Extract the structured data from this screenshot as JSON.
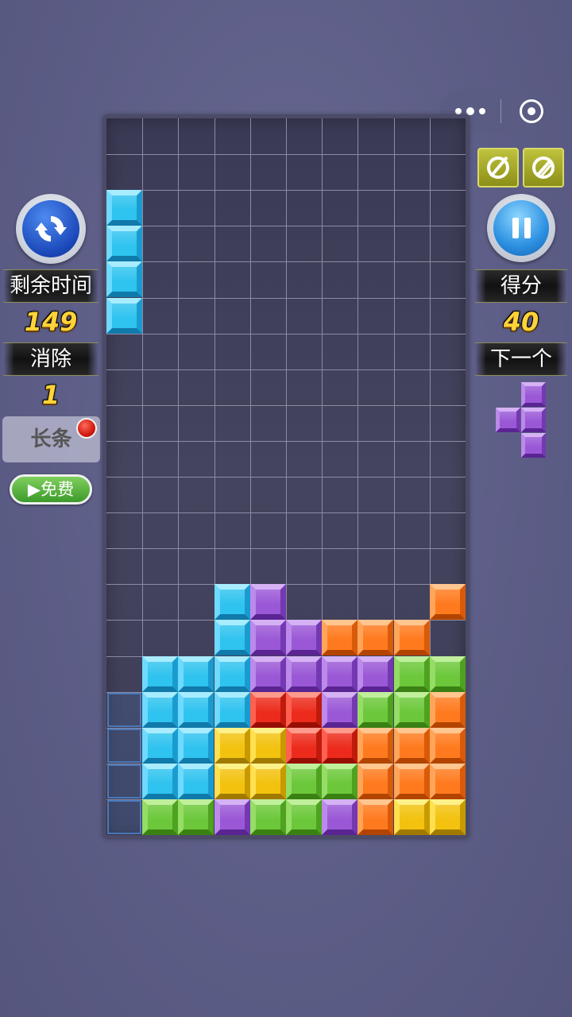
{
  "capsule": {
    "more_icon": "more-dots-icon",
    "close_icon": "target-circle-icon"
  },
  "left_panel": {
    "restart_icon": "refresh-arrows-icon",
    "time_label": "剩余时间",
    "time_value": "149",
    "lines_label": "消除",
    "lines_value": "1",
    "powerup_label": "长条",
    "free_button_label": "▶免费"
  },
  "right_panel": {
    "sound_icon": "sound-off-icon",
    "music_icon": "music-off-icon",
    "pause_icon": "pause-icon",
    "score_label": "得分",
    "score_value": "40",
    "next_label": "下一个",
    "next_piece": {
      "color": "purple",
      "cells": [
        [
          1,
          0
        ],
        [
          0,
          1
        ],
        [
          1,
          1
        ],
        [
          1,
          2
        ]
      ]
    }
  },
  "colors": {
    "cyan": {
      "c": "#2fc3ef",
      "lt": "#a8ecff",
      "ml": "#6fdaff",
      "md": "#1a9bd0",
      "dk": "#107aaa"
    },
    "purple": {
      "c": "#9a58d6",
      "lt": "#d5b2f4",
      "ml": "#bb8aea",
      "md": "#7438b3",
      "dk": "#5a2592"
    },
    "orange": {
      "c": "#ff7a1e",
      "lt": "#ffc690",
      "ml": "#ffa55a",
      "md": "#d95a08",
      "dk": "#b34400"
    },
    "green": {
      "c": "#6cc83a",
      "lt": "#c0ef9c",
      "ml": "#95dd66",
      "md": "#4ea21f",
      "dk": "#3a8013"
    },
    "red": {
      "c": "#ec2b1c",
      "lt": "#ff9a8c",
      "ml": "#ff6050",
      "md": "#c01a0c",
      "dk": "#970e04"
    },
    "yellow": {
      "c": "#f2c20f",
      "lt": "#fff18a",
      "ml": "#ffe050",
      "md": "#c89a00",
      "dk": "#a07a00"
    }
  },
  "board": {
    "cols": 10,
    "rows": 20,
    "active_piece": {
      "color": "cyan",
      "cells": [
        [
          0,
          2
        ],
        [
          0,
          3
        ],
        [
          0,
          4
        ],
        [
          0,
          5
        ]
      ]
    },
    "ghost_cells": [
      [
        0,
        16
      ],
      [
        0,
        17
      ],
      [
        0,
        18
      ],
      [
        0,
        19
      ]
    ],
    "rows_data": [
      "..........",
      "..........",
      "..........",
      "..........",
      "..........",
      "..........",
      "..........",
      "..........",
      "..........",
      "..........",
      "..........",
      "..........",
      "..........",
      "...CP....O.",
      "...CPPOOO.",
      ".CCCPPPPGG",
      ".CCCRRPGGO",
      ".CCYYRROOO",
      ".CCYYGGOOO",
      ".GGPGGPOYY"
    ]
  }
}
